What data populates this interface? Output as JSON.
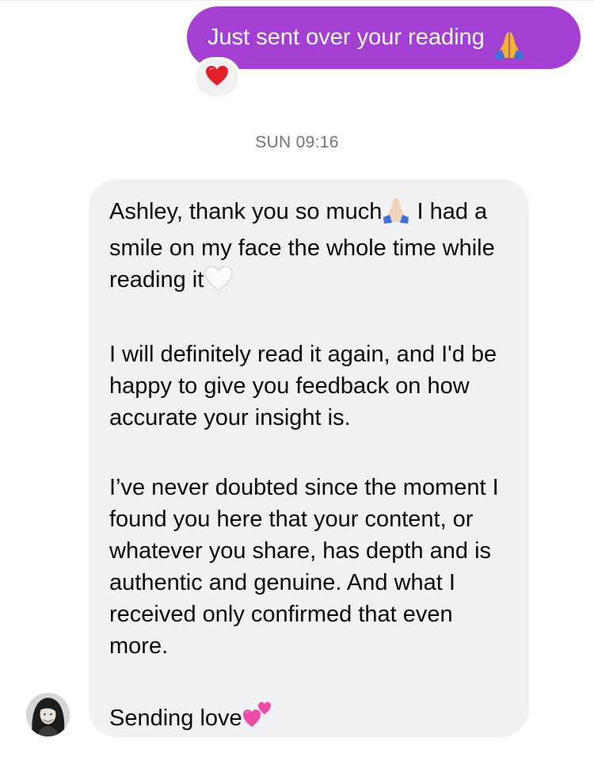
{
  "sent_message": {
    "text": "Just sent over your reading",
    "emoji_icon": "folded-hands-icon",
    "bubble_color": "#a33fd1",
    "reaction_icon": "red-heart-icon"
  },
  "timestamp": "SUN 09:16",
  "received_message": {
    "bubble_color": "#f1f1f4",
    "paragraphs": {
      "p1_line1": "Ashley, thank you so much",
      "p1_after_emoji": " I had a smile on my face the whole time while reading it",
      "p2": "I will definitely read it again, and I'd be happy to give you feedback on how accurate your insight is.",
      "p3": "I’ve never doubted since the moment I found you here that your content, or whatever you share, has depth and is authentic and genuine. And what I received only confirmed that even more.",
      "p4": "Sending love"
    },
    "emoji_icons": [
      "folded-hands-light-skin-icon",
      "white-heart-icon",
      "two-hearts-icon"
    ]
  },
  "sender_avatar": "avatar"
}
